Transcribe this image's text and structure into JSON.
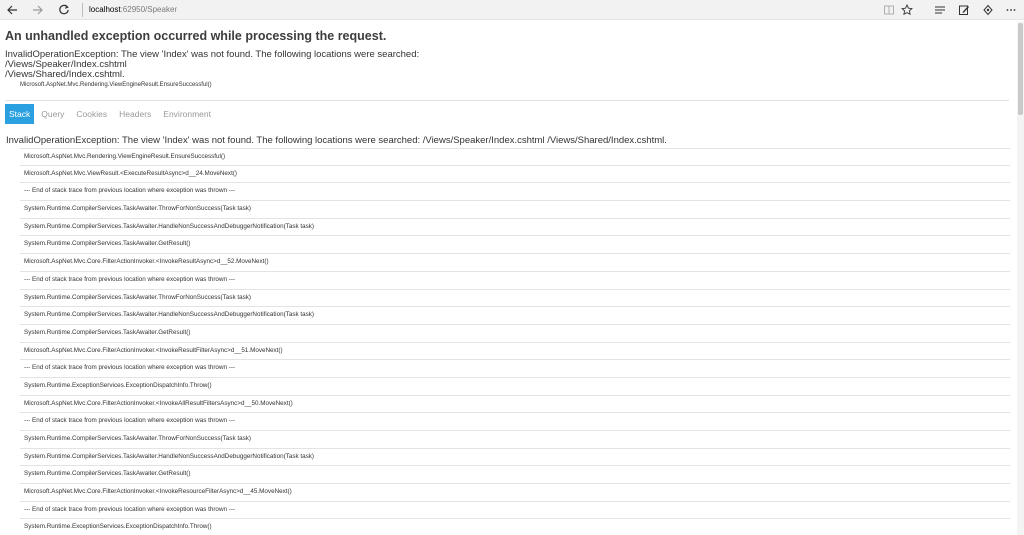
{
  "browser": {
    "address": {
      "host": "localhost",
      "rest": ":62950/Speaker"
    },
    "icons": [
      "back-arrow-icon",
      "forward-arrow-icon",
      "refresh-icon",
      "reading-view-icon",
      "favorite-star-icon",
      "hub-icon",
      "web-note-icon",
      "share-icon",
      "more-icon"
    ]
  },
  "error": {
    "title": "An unhandled exception occurred while processing the request.",
    "message_lines": [
      "InvalidOperationException: The view 'Index' was not found. The following locations were searched:",
      "/Views/Speaker/Index.cshtml",
      "/Views/Shared/Index.cshtml."
    ],
    "location": "Microsoft.AspNet.Mvc.Rendering.ViewEngineResult.EnsureSuccessful()"
  },
  "tabs": [
    {
      "label": "Stack",
      "active": true
    },
    {
      "label": "Query",
      "active": false
    },
    {
      "label": "Cookies",
      "active": false
    },
    {
      "label": "Headers",
      "active": false
    },
    {
      "label": "Environment",
      "active": false
    }
  ],
  "stack": {
    "exception_header": "InvalidOperationException: The view 'Index' was not found. The following locations were searched: /Views/Speaker/Index.cshtml /Views/Shared/Index.cshtml.",
    "frames": [
      "Microsoft.AspNet.Mvc.Rendering.ViewEngineResult.EnsureSuccessful()",
      "Microsoft.AspNet.Mvc.ViewResult.<ExecuteResultAsync>d__24.MoveNext()",
      "--- End of stack trace from previous location where exception was thrown ---",
      "System.Runtime.CompilerServices.TaskAwaiter.ThrowForNonSuccess(Task task)",
      "System.Runtime.CompilerServices.TaskAwaiter.HandleNonSuccessAndDebuggerNotification(Task task)",
      "System.Runtime.CompilerServices.TaskAwaiter.GetResult()",
      "Microsoft.AspNet.Mvc.Core.FilterActionInvoker.<InvokeResultAsync>d__52.MoveNext()",
      "--- End of stack trace from previous location where exception was thrown ---",
      "System.Runtime.CompilerServices.TaskAwaiter.ThrowForNonSuccess(Task task)",
      "System.Runtime.CompilerServices.TaskAwaiter.HandleNonSuccessAndDebuggerNotification(Task task)",
      "System.Runtime.CompilerServices.TaskAwaiter.GetResult()",
      "Microsoft.AspNet.Mvc.Core.FilterActionInvoker.<InvokeResultFilterAsync>d__51.MoveNext()",
      "--- End of stack trace from previous location where exception was thrown ---",
      "System.Runtime.ExceptionServices.ExceptionDispatchInfo.Throw()",
      "Microsoft.AspNet.Mvc.Core.FilterActionInvoker.<InvokeAllResultFiltersAsync>d__50.MoveNext()",
      "--- End of stack trace from previous location where exception was thrown ---",
      "System.Runtime.CompilerServices.TaskAwaiter.ThrowForNonSuccess(Task task)",
      "System.Runtime.CompilerServices.TaskAwaiter.HandleNonSuccessAndDebuggerNotification(Task task)",
      "System.Runtime.CompilerServices.TaskAwaiter.GetResult()",
      "Microsoft.AspNet.Mvc.Core.FilterActionInvoker.<InvokeResourceFilterAsync>d__45.MoveNext()",
      "--- End of stack trace from previous location where exception was thrown ---",
      "System.Runtime.ExceptionServices.ExceptionDispatchInfo.Throw()"
    ]
  },
  "colors": {
    "active_tab": "#2ba0e0",
    "inactive_tab_text": "#9a9a9a",
    "title_text": "#3d3d3d",
    "row_border": "#e3e3e3"
  }
}
